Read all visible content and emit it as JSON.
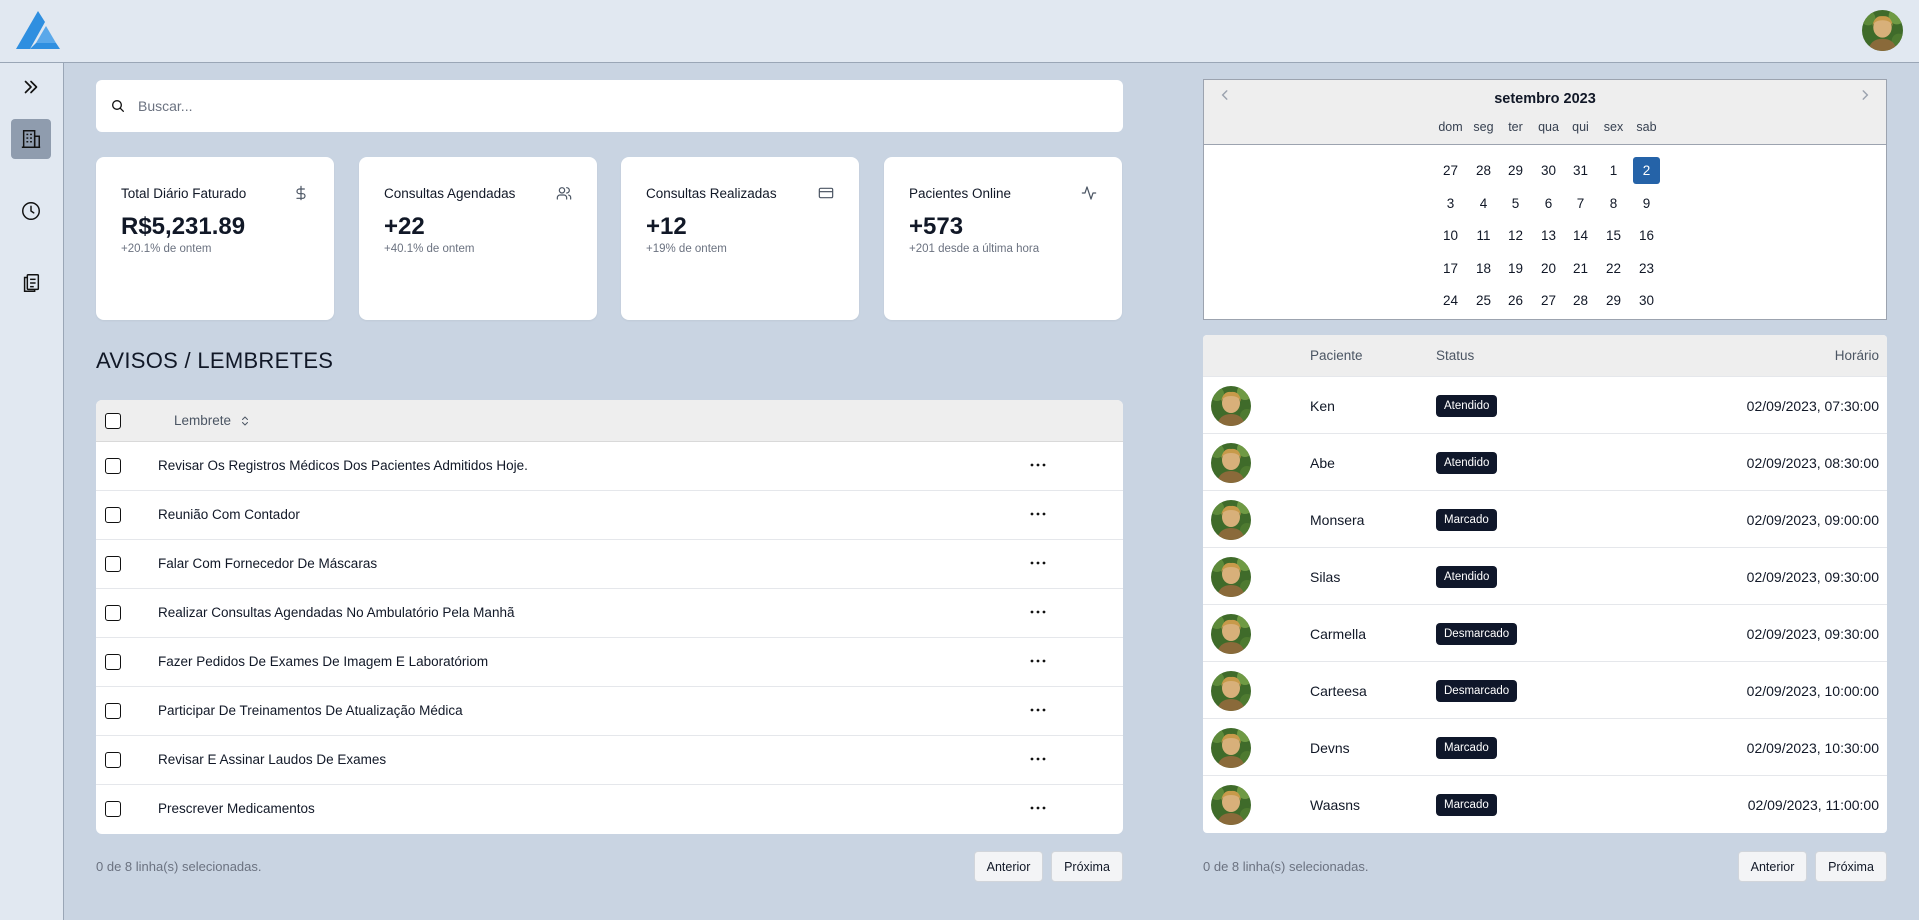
{
  "colors": {
    "page_bg": "#c9d4e2",
    "topbar_bg": "#e1e8f1",
    "logo_blue": "#2f8fe0",
    "selected_day": "#2563a8",
    "badge_bg": "#0f172a"
  },
  "icons": {
    "logo": "triangle-a-logo-icon",
    "sidebar_toggle": "chevrons-right-icon",
    "sidebar_dashboard": "building-icon",
    "sidebar_history": "clock-icon",
    "sidebar_records": "clipboard-icon",
    "search": "search-icon",
    "revenue": "dollar-icon",
    "scheduled": "users-icon",
    "done": "credit-card-icon",
    "online": "activity-icon",
    "sort": "sort-icon",
    "row_actions": "more-horizontal-icon"
  },
  "search": {
    "placeholder": "Buscar..."
  },
  "stats": [
    {
      "title": "Total Diário Faturado",
      "value": "R$5,231.89",
      "sub": "+20.1% de ontem"
    },
    {
      "title": "Consultas Agendadas",
      "value": "+22",
      "sub": "+40.1% de ontem"
    },
    {
      "title": "Consultas Realizadas",
      "value": "+12",
      "sub": "+19% de ontem"
    },
    {
      "title": "Pacientes Online",
      "value": "+573",
      "sub": "+201 desde a última hora"
    }
  ],
  "reminders": {
    "title": "AVISOS / LEMBRETES",
    "column": "Lembrete",
    "items": [
      "Revisar Os Registros Médicos Dos Pacientes Admitidos Hoje.",
      "Reunião Com Contador",
      "Falar Com Fornecedor De Máscaras",
      "Realizar Consultas Agendadas No Ambulatório Pela Manhã",
      "Fazer Pedidos De Exames De Imagem E Laboratóriom",
      "Participar De Treinamentos De Atualização Médica",
      "Revisar E Assinar Laudos De Exames",
      "Prescrever Medicamentos"
    ],
    "footer": "0 de 8 linha(s) selecionadas.",
    "prev": "Anterior",
    "next": "Próxima"
  },
  "calendar": {
    "title": "setembro 2023",
    "weekdays": [
      "dom",
      "seg",
      "ter",
      "qua",
      "qui",
      "sex",
      "sab"
    ],
    "weeks": [
      [
        "27",
        "28",
        "29",
        "30",
        "31",
        "1",
        "2"
      ],
      [
        "3",
        "4",
        "5",
        "6",
        "7",
        "8",
        "9"
      ],
      [
        "10",
        "11",
        "12",
        "13",
        "14",
        "15",
        "16"
      ],
      [
        "17",
        "18",
        "19",
        "20",
        "21",
        "22",
        "23"
      ],
      [
        "24",
        "25",
        "26",
        "27",
        "28",
        "29",
        "30"
      ]
    ],
    "selected": "2"
  },
  "patients": {
    "columns": {
      "patient": "Paciente",
      "status": "Status",
      "time": "Horário"
    },
    "rows": [
      {
        "name": "Ken",
        "status": "Atendido",
        "time": "02/09/2023, 07:30:00"
      },
      {
        "name": "Abe",
        "status": "Atendido",
        "time": "02/09/2023, 08:30:00"
      },
      {
        "name": "Monsera",
        "status": "Marcado",
        "time": "02/09/2023, 09:00:00"
      },
      {
        "name": "Silas",
        "status": "Atendido",
        "time": "02/09/2023, 09:30:00"
      },
      {
        "name": "Carmella",
        "status": "Desmarcado",
        "time": "02/09/2023, 09:30:00"
      },
      {
        "name": "Carteesa",
        "status": "Desmarcado",
        "time": "02/09/2023, 10:00:00"
      },
      {
        "name": "Devns",
        "status": "Marcado",
        "time": "02/09/2023, 10:30:00"
      },
      {
        "name": "Waasns",
        "status": "Marcado",
        "time": "02/09/2023, 11:00:00"
      }
    ],
    "footer": "0 de 8 linha(s) selecionadas.",
    "prev": "Anterior",
    "next": "Próxima"
  }
}
